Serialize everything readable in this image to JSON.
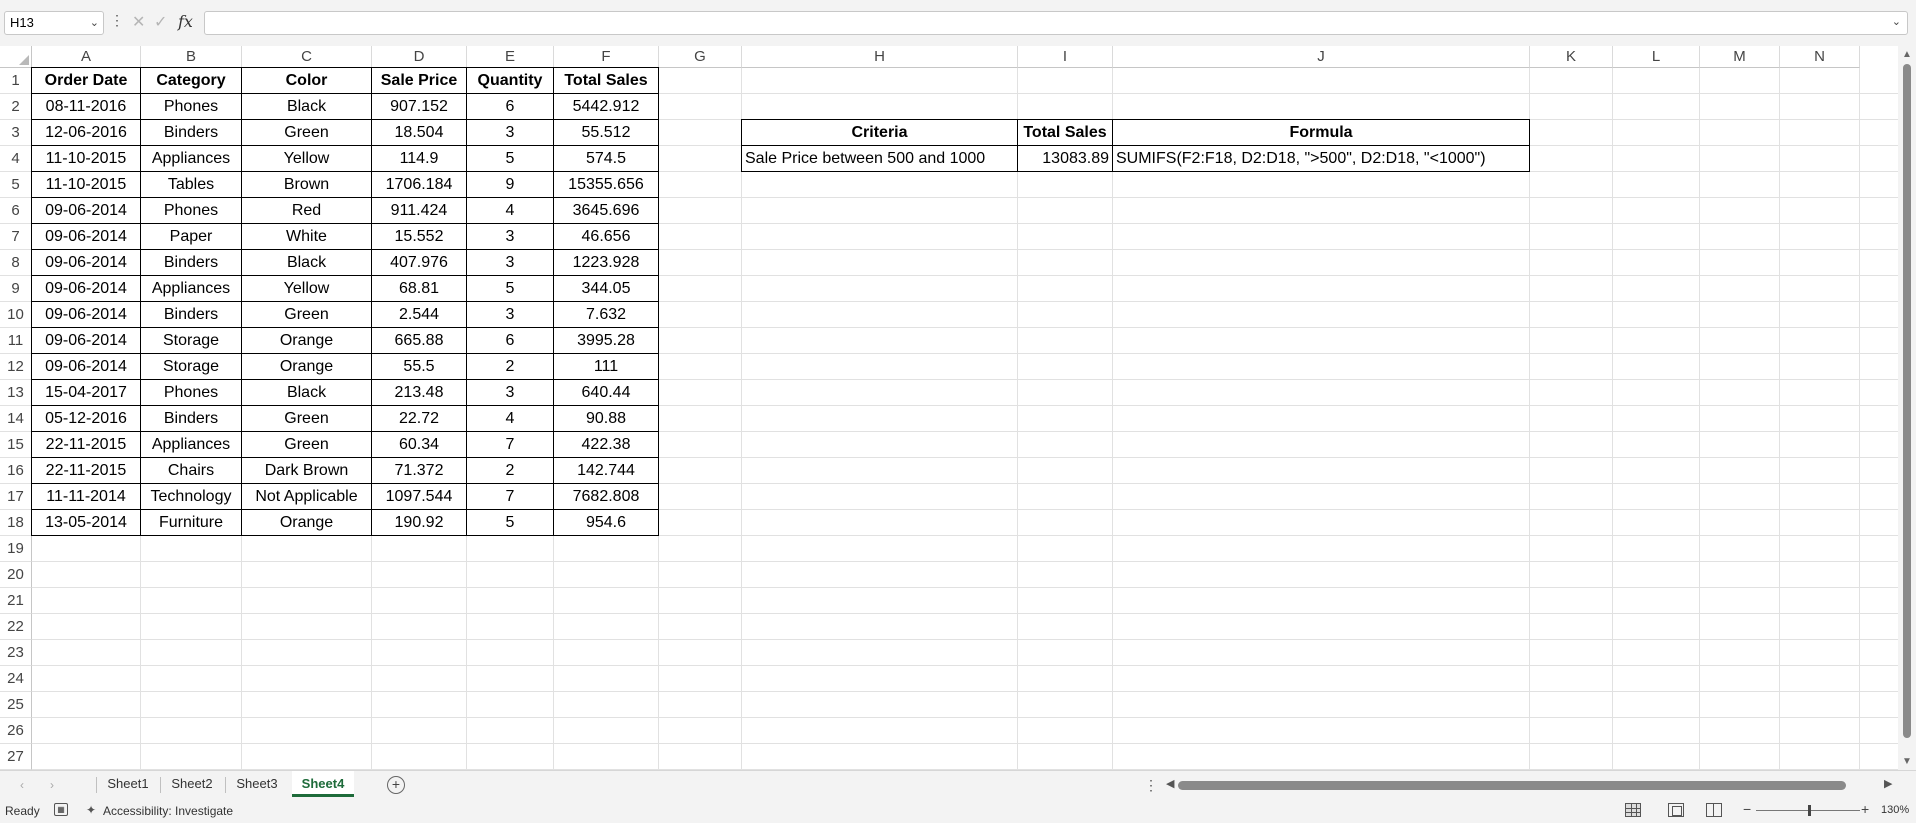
{
  "formula_bar": {
    "name_box": "H13",
    "fx_label": "fx",
    "formula": ""
  },
  "columns": [
    "A",
    "B",
    "C",
    "D",
    "E",
    "F",
    "G",
    "H",
    "I",
    "J",
    "K",
    "L",
    "M",
    "N"
  ],
  "rows": [
    "1",
    "2",
    "3",
    "4",
    "5",
    "6",
    "7",
    "8",
    "9",
    "10",
    "11",
    "12",
    "13",
    "14",
    "15",
    "16",
    "17",
    "18",
    "19",
    "20",
    "21",
    "22",
    "23",
    "24",
    "25",
    "26",
    "27"
  ],
  "table": {
    "headers": [
      "Order Date",
      "Category",
      "Color",
      "Sale Price",
      "Quantity",
      "Total Sales"
    ],
    "rows": [
      [
        "08-11-2016",
        "Phones",
        "Black",
        "907.152",
        "6",
        "5442.912"
      ],
      [
        "12-06-2016",
        "Binders",
        "Green",
        "18.504",
        "3",
        "55.512"
      ],
      [
        "11-10-2015",
        "Appliances",
        "Yellow",
        "114.9",
        "5",
        "574.5"
      ],
      [
        "11-10-2015",
        "Tables",
        "Brown",
        "1706.184",
        "9",
        "15355.656"
      ],
      [
        "09-06-2014",
        "Phones",
        "Red",
        "911.424",
        "4",
        "3645.696"
      ],
      [
        "09-06-2014",
        "Paper",
        "White",
        "15.552",
        "3",
        "46.656"
      ],
      [
        "09-06-2014",
        "Binders",
        "Black",
        "407.976",
        "3",
        "1223.928"
      ],
      [
        "09-06-2014",
        "Appliances",
        "Yellow",
        "68.81",
        "5",
        "344.05"
      ],
      [
        "09-06-2014",
        "Binders",
        "Green",
        "2.544",
        "3",
        "7.632"
      ],
      [
        "09-06-2014",
        "Storage",
        "Orange",
        "665.88",
        "6",
        "3995.28"
      ],
      [
        "09-06-2014",
        "Storage",
        "Orange",
        "55.5",
        "2",
        "111"
      ],
      [
        "15-04-2017",
        "Phones",
        "Black",
        "213.48",
        "3",
        "640.44"
      ],
      [
        "05-12-2016",
        "Binders",
        "Green",
        "22.72",
        "4",
        "90.88"
      ],
      [
        "22-11-2015",
        "Appliances",
        "Green",
        "60.34",
        "7",
        "422.38"
      ],
      [
        "22-11-2015",
        "Chairs",
        "Dark Brown",
        "71.372",
        "2",
        "142.744"
      ],
      [
        "11-11-2014",
        "Technology",
        "Not Applicable",
        "1097.544",
        "7",
        "7682.808"
      ],
      [
        "13-05-2014",
        "Furniture",
        "Orange",
        "190.92",
        "5",
        "954.6"
      ]
    ]
  },
  "criteria_table": {
    "headers": [
      "Criteria",
      "Total Sales",
      "Formula"
    ],
    "row": [
      "Sale Price between 500 and 1000",
      "13083.89",
      "SUMIFS(F2:F18, D2:D18, \">500\", D2:D18, \"<1000\")"
    ]
  },
  "sheet_tabs": [
    "Sheet1",
    "Sheet2",
    "Sheet3",
    "Sheet4"
  ],
  "active_sheet": "Sheet4",
  "status": {
    "ready": "Ready",
    "accessibility": "Accessibility: Investigate",
    "zoom": "130%"
  },
  "colors": {
    "active_tab": "#1e6b3a",
    "chrome_bg": "#f3f3f3",
    "gridline": "#e1e1e1"
  }
}
